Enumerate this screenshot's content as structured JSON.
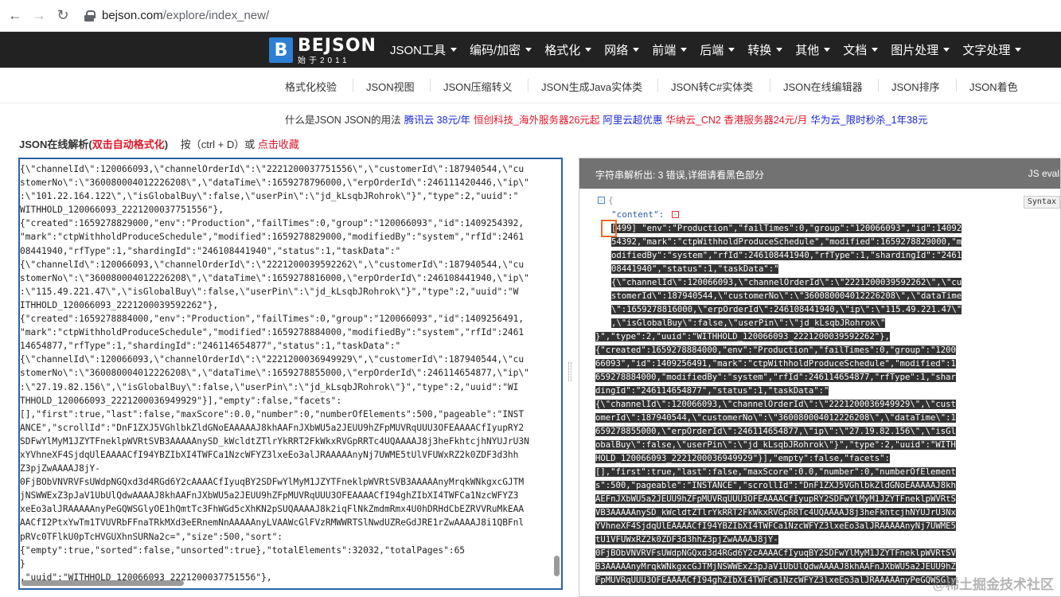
{
  "browser": {
    "url_host": "bejson.com",
    "url_path": "/explore/index_new/"
  },
  "logo": {
    "mark": "B",
    "name": "BEJSON",
    "sub": "始于2011"
  },
  "main_menu": [
    "JSON工具",
    "编码/加密",
    "格式化",
    "网络",
    "前端",
    "后端",
    "转换",
    "其他",
    "文档",
    "图片处理",
    "文字处理"
  ],
  "sub_nav": [
    "格式化校验",
    "JSON视图",
    "JSON压缩转义",
    "JSON生成Java实体类",
    "JSON转C#实体类",
    "JSON在线编辑器",
    "JSON排序",
    "JSON着色"
  ],
  "ads": [
    {
      "text": "什么是JSON",
      "color": "black"
    },
    {
      "text": "JSON的用法",
      "color": "black"
    },
    {
      "text": "腾讯云 38元/年",
      "color": "blue"
    },
    {
      "text": "恒创科技_海外服务器26元起",
      "color": "red"
    },
    {
      "text": "阿里云超优惠",
      "color": "blue"
    },
    {
      "text": "华纳云_CN2 香港服务器24元/月",
      "color": "red"
    },
    {
      "text": "华为云_限时秒杀_1年38元",
      "color": "blue"
    }
  ],
  "title": {
    "main": "JSON在线解析(",
    "red": "双击自动格式化",
    "close": ")",
    "hint": "按（ctrl + D）或",
    "link": "点击收藏"
  },
  "editor_lines": [
    "{\\\"channelId\\\":120066093,\\\"channelOrderId\\\":\\\"2221200037751556\\\",\\\"customerId\\\":187940544,\\\"cu",
    "stomerNo\\\":\\\"360080004012226208\\\",\\\"dataTime\\\":1659278796000,\\\"erpOrderId\\\":246111420446,\\\"ip\\\"",
    ":\\\"101.22.164.122\\\",\\\"isGlobalBuy\\\":false,\\\"userPin\\\":\\\"jd_kLsqbJRohrok\\\"}\",\"type\":2,\"uuid\":\"",
    "WITHHOLD_120066093_2221200037751556\"},",
    "{\"created\":1659278829000,\"env\":\"Production\",\"failTimes\":0,\"group\":\"120066093\",\"id\":1409254392,",
    "\"mark\":\"ctpWithholdProduceSchedule\",\"modified\":1659278829000,\"modifiedBy\":\"system\",\"rfId\":2461",
    "08441940,\"rfType\":1,\"shardingId\":\"246108441940\",\"status\":1,\"taskData\":\"",
    "{\\\"channelId\\\":120066093,\\\"channelOrderId\\\":\\\"2221200039592262\\\",\\\"customerId\\\":187940544,\\\"cu",
    "stomerNo\\\":\\\"360080004012226208\\\",\\\"dataTime\\\":1659278816000,\\\"erpOrderId\\\":246108441940,\\\"ip\\\"",
    ":\\\"115.49.221.47\\\",\\\"isGlobalBuy\\\":false,\\\"userPin\\\":\\\"jd_kLsqbJRohrok\\\"}\",\"type\":2,\"uuid\":\"W",
    "ITHHOLD_120066093_2221200039592262\"},",
    "{\"created\":1659278884000,\"env\":\"Production\",\"failTimes\":0,\"group\":\"120066093\",\"id\":1409256491,",
    "\"mark\":\"ctpWithholdProduceSchedule\",\"modified\":1659278884000,\"modifiedBy\":\"system\",\"rfId\":2461",
    "14654877,\"rfType\":1,\"shardingId\":\"246114654877\",\"status\":1,\"taskData\":\"",
    "{\\\"channelId\\\":120066093,\\\"channelOrderId\\\":\\\"2221200036949929\\\",\\\"customerId\\\":187940544,\\\"cu",
    "stomerNo\\\":\\\"360080004012226208\\\",\\\"dataTime\\\":1659278855000,\\\"erpOrderId\\\":246114654877,\\\"ip\\\"",
    ":\\\"27.19.82.156\\\",\\\"isGlobalBuy\\\":false,\\\"userPin\\\":\\\"jd_kLsqbJRohrok\\\"}\",\"type\":2,\"uuid\":\"WI",
    "THHOLD_120066093_2221200036949929\"}],\"empty\":false,\"facets\":",
    "[],\"first\":true,\"last\":false,\"maxScore\":0.0,\"number\":0,\"numberOfElements\":500,\"pageable\":\"INST",
    "ANCE\",\"scrollId\":\"DnF1ZXJ5VGhlbkZldGNoEAAAAAJ8khAAFnJXbWU5a2JEUU9hZFpMUVRqUUU3OFEAAAACfIyupRY2",
    "SDFwYlMyM1JZYTFneklpWVRtSVB3AAAAAnySD_kWcldtZTlrYkRRT2FkWkxRVGpRRTc4UQAAAAJ8j3heFkhtcjhNYUJrU3N",
    "xYVhneXF4SjdqUlEAAAACfI94YBZIbXI4TWFCa1NzcWFYZ3lxeEo3alJRAAAAAnyNj7UWME5tUlVFUWxRZ2k0ZDF3d3hh",
    "Z3pjZwAAAAJ8jY-",
    "0FjBObVNVRVFsUWdpNGQxd3d4RGd6Y2cAAAACfIyuqBY2SDFwYlMyM1JZYTFneklpWVRtSVB3AAAAAnyMrqkWNkgxcGJTM",
    "jNSWWExZ3pJaV1UbUlQdwAAAAJ8khAAFnJXbWU5a2JEUU9hZFpMUVRqUUU3OFEAAAACfI94ghZIbXI4TWFCa1NzcWFYZ3",
    "xeEo3alJRAAAAAnyPeGQWSGlyOE1hQmtTc3FhWGd5cXhKN2pSUQAAAAJ8k2iqFlNkZmdmRmx4U0hDRHdCbEZRVVRuMkEAA",
    "AACfI2PtxYwTm1TVUVRbFFnaTRkMXd3eERnemNnAAAAAnyLVAAWcGlFVzRMWWRTSlNwdUZReGdJRE1rZwAAAAJ8i1QBFnl",
    "pRVc0TFlkU0pTcHVGUXhnSURNa2c=\",\"size\":500,\"sort\":",
    "{\"empty\":true,\"sorted\":false,\"unsorted\":true},\"totalElements\":32032,\"totalPages\":65",
    "}",
    ",\"uuid\":\"WITHHOLD_120066093_2221200037751556\"},"
  ],
  "result": {
    "header_msg": "字符串解析出: 3 错误,详细请看黑色部分",
    "eval_label": "JS eval",
    "syntax_tag": "Syntax",
    "open_brace": "{",
    "content_key": "\"content\":",
    "error_lines": [
      "[499] \"env\":\"Production\",\"failTimes\":0,\"group\":\"120066093\",\"id\":14092",
      "54392,\"mark\":\"ctpWithholdProduceSchedule\",\"modified\":1659278829000,\"m",
      "odifiedBy\":\"system\",\"rfId\":246108441940,\"rfType\":1,\"shardingId\":\"2461",
      "08441940\",\"status\":1,\"taskData\":\"",
      "{\\\"channelId\\\":120066093,\\\"channelOrderId\\\":\\\"2221200039592262\\\",\\\"cu",
      "stomerId\\\":187940544,\\\"customerNo\\\":\\\"360080004012226208\\\",\\\"dataTime",
      "\\\":1659278816000,\\\"erpOrderId\\\":246108441940,\\\"ip\\\":\\\"115.49.221.47\\\"",
      ",\\\"isGlobalBuy\\\":false,\\\"userPin\\\":\\\"jd_kLsqbJRohrok\\\""
    ],
    "error_lines2": [
      "}\",\"type\":2,\"uuid\":\"WITHHOLD_120066093_2221200039592262\"},",
      "{\"created\":1659278884000,\"env\":\"Production\",\"failTimes\":0,\"group\":\"1200",
      "66093\",\"id\":1409256491,\"mark\":\"ctpWithholdProduceSchedule\",\"modified\":1",
      "659278884000,\"modifiedBy\":\"system\",\"rfId\":246114654877,\"rfType\":1,\"shar",
      "dingId\":\"246114654877\",\"status\":1,\"taskData\":\"",
      "{\\\"channelId\\\":120066093,\\\"channelOrderId\\\":\\\"2221200036949929\\\",\\\"cust",
      "omerId\\\":187940544,\\\"customerNo\\\":\\\"360080004012226208\\\",\\\"dataTime\\\":1",
      "659278855000,\\\"erpOrderId\\\":246114654877,\\\"ip\\\":\\\"27.19.82.156\\\",\\\"isGl",
      "obalBuy\\\":false,\\\"userPin\\\":\\\"jd_kLsqbJRohrok\\\"}\",\"type\":2,\"uuid\":\"WITH",
      "HOLD_120066093_2221200036949929\"}],\"empty\":false,\"facets\":",
      "[],\"first\":true,\"last\":false,\"maxScore\":0.0,\"number\":0,\"numberOfElement",
      "s\":500,\"pageable\":\"INSTANCE\",\"scrollId\":\"DnF1ZXJ5VGhlbkZldGNoEAAAAAJ8kh",
      "AEFnJXbWU5a2JEUU9hZFpMUVRqUUU3OFEAAAACfIyupRY2SDFwYlMyM1JZYTFneklpWVRtS",
      "VB3AAAAAnySD_kWcldtZTlrYkRRT2FkWkxRVGpRRTc4UQAAAAJ8j3heFkhtcjhNYUJrU3Nx",
      "YVhneXF4SjdqUlEAAAACfI94YBZIbXI4TWFCa1NzcWFYZ3lxeEo3alJRAAAAAnyNj7UWME5",
      "tU1VFUWxRZ2k0ZDF3d3hhZ3pjZwAAAAJ8jY-",
      "0FjBObVNVRVFsUWdpNGQxd3d4RGd6Y2cAAAACfIyuqBY2SDFwYlMyM1JZYTFneklpWVRtSV",
      "B3AAAAAnyMrqkWNkgxcGJTMjNSWWExZ3pJaV1UbUlQdwAAAAJ8khAAFnJXbWU5a2JEUU9hZ",
      "FpMUVRqUUU3OFEAAAACfI94ghZIbXI4TWFCa1NzcWFYZ3lxeEo3alJRAAAAAnyPeGQWSGly"
    ]
  },
  "watermark": "@稀土掘金技术社区"
}
